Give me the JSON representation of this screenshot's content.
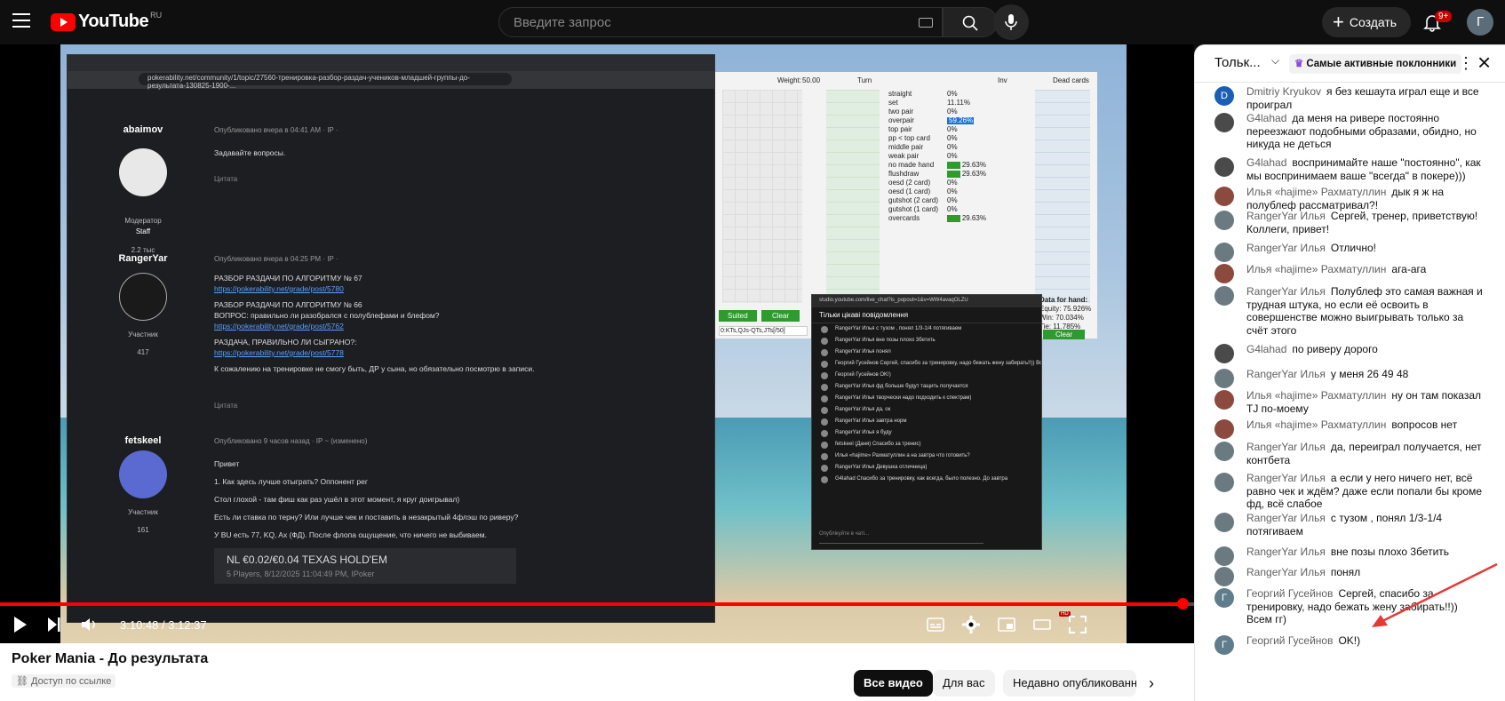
{
  "masthead": {
    "logo_text": "YouTube",
    "region": "RU",
    "search_placeholder": "Введите запрос",
    "create_label": "Создать",
    "notifications_count": "9+",
    "avatar_letter": "Г"
  },
  "player": {
    "current_time": "3:10:48",
    "duration": "3:12:37",
    "time_display": "3:10:48 / 3:12:37",
    "progress_fraction": 0.99,
    "hd_badge": "HD",
    "forum": {
      "url": "pokerability.net/community/1/topic/27560-тренировка-разбор-раздач-учеников-младшей-группы-до-результата-130825-1900-...",
      "posts": [
        {
          "author": "abaimov",
          "role": "Модератор",
          "badge": "Staff",
          "count": "2.2 тыс",
          "meta": "Опубликовано вчера в 04:41 AM · IP ·",
          "body": [
            "Задавайте вопросы."
          ],
          "quote": "Цитата"
        },
        {
          "author": "RangerYar",
          "role": "Участник",
          "count": "417",
          "meta": "Опубликовано вчера в 04:25 PM · IP ·",
          "body": [
            "РАЗБОР РАЗДАЧИ ПО АЛГОРИТМУ № 67",
            "https://pokerability.net/grade/post/5780",
            "РАЗБОР РАЗДАЧИ ПО АЛГОРИТМУ № 66",
            "ВОПРОС: правильно ли разобрался с полублефами и блефом?",
            "https://pokerability.net/grade/post/5762",
            "РАЗДАЧА, ПРАВИЛЬНО ЛИ СЫГРАНО?:",
            "https://pokerability.net/grade/post/5778",
            "К сожалению на тренировке не смогу быть, ДР у сына, но обязательно посмотрю в записи."
          ],
          "quote": "Цитата"
        },
        {
          "author": "fetskeel",
          "role": "Участник",
          "count": "161",
          "meta": "Опубликовано 9 часов назад · IP ~ (изменено)",
          "body": [
            "Привет",
            "1. Как здесь лучше отыграть? Оппонент рег",
            "Стол глохой - там фиш как раз ушёл в этот момент, я круг доигрывал)",
            "Есть ли ставка по терну? Или лучше чек и поставить в незакрытый 4флэш по риверу?",
            "У BU есть 77, KQ, Ax (ФД). После флопа ощущение, что ничего не выбиваем."
          ],
          "hand_title": "NL €0.02/€0.04 TEXAS HOLD'EM",
          "hand_sub": "5 Players, 8/12/2025 11:04:49 PM, IPoker"
        }
      ]
    },
    "calc": {
      "weight_label": "Weight:",
      "weight_value": "50.00",
      "turn_label": "Turn",
      "inv_label": "Inv",
      "dead_label": "Dead cards",
      "data_for_hand": "Data for hand:",
      "equity": "Equity: 75.926%",
      "win": "Win: 70.034%",
      "tie": "Tie: 11.785%",
      "suited": "Suited",
      "clear": "Clear",
      "clear2": "Clear",
      "range_text": "0:KTs,QJs-QTs,JTs[/50]",
      "stats": [
        {
          "name": "straight",
          "pct": "0%",
          "bar": 0
        },
        {
          "name": "set",
          "pct": "11.11%",
          "bar": 0
        },
        {
          "name": "two pair",
          "pct": "0%",
          "bar": 0
        },
        {
          "name": "overpair",
          "pct": "59.26%",
          "bar": 59.26
        },
        {
          "name": "top pair",
          "pct": "0%",
          "bar": 0
        },
        {
          "name": "pp < top card",
          "pct": "0%",
          "bar": 0
        },
        {
          "name": "middle pair",
          "pct": "0%",
          "bar": 0
        },
        {
          "name": "weak pair",
          "pct": "0%",
          "bar": 0
        },
        {
          "name": "no made hand",
          "pct": "29.63%",
          "bar": 29.63
        },
        {
          "name": "flushdraw",
          "pct": "29.63%",
          "bar": 29.63
        },
        {
          "name": "oesd (2 card)",
          "pct": "0%",
          "bar": 0
        },
        {
          "name": "oesd (1 card)",
          "pct": "0%",
          "bar": 0
        },
        {
          "name": "gutshot (2 card)",
          "pct": "0%",
          "bar": 0
        },
        {
          "name": "gutshot (1 card)",
          "pct": "0%",
          "bar": 0
        },
        {
          "name": "overcards",
          "pct": "29.63%",
          "bar": 29.63
        }
      ]
    },
    "popup_chat": {
      "title": "studio.youtube.com/live_chat?is_popout=1&v=WW4avaqOLZU",
      "mode": "Тільки цікаві повідомлення",
      "input_placeholder": "Опублікуйте в чаті...",
      "messages": [
        "RangerYar Илья  с тузом , понял 1/3-1/4 потягиваем",
        "RangerYar Илья  вне позы плохо 3бетить",
        "RangerYar Илья  понял",
        "Георгий Гусейнов  Сергей, спасибо за тренировку, надо бежать жену забирать!!)) Всем гг)",
        "Георгий Гусейнов  OK!)",
        "RangerYar Илья  фд больше будут тащить получается",
        "RangerYar Илья  творчески надо подходить к спектрам)",
        "RangerYar Илья  да, ок",
        "RangerYar Илья  завтра норм",
        "RangerYar Илья  я буду",
        "fetskeel (Даня)  Спасибо за тренис)",
        "Илья «hajime» Рахматуллин  а на завтра что готовить?",
        "RangerYar Илья  Девушка отличница)",
        "G4lahad  Спасибо за тренировку, как всегда, было полезно. До завтра"
      ]
    }
  },
  "below": {
    "title": "Poker Mania - До результата",
    "privacy": "Доступ по ссылке",
    "chips": [
      "Все видео",
      "Для вас",
      "Недавно опубликованн"
    ]
  },
  "chat": {
    "mode": "Тольк...",
    "top_fans": "Самые активные поклонники",
    "messages": [
      {
        "author": "Dmitriy Kryukov",
        "text": "я без кешаута играл еще и все проиграл",
        "avatar_letter": "D",
        "avatar_color": "#1a5fb4"
      },
      {
        "author": "G4lahad",
        "text": "да меня на ривере постоянно переезжают подобными образами, обидно, но никуда не деться",
        "avatar_letter": "",
        "avatar_color": "#4a4a4a"
      },
      {
        "author": "G4lahad",
        "text": "воспринимайте наше \"постоянно\", как мы воспринимаем ваше \"всегда\" в покере)))",
        "avatar_letter": "",
        "avatar_color": "#4a4a4a"
      },
      {
        "author": "Илья «hajime» Рахматуллин",
        "text": "дык я ж на полублеф рассматривал?!",
        "avatar_letter": "",
        "avatar_color": "#8c4a3e"
      },
      {
        "author": "RangerYar Илья",
        "text": "Сергей, тренер, приветствую! Коллеги, привет!",
        "avatar_letter": "",
        "avatar_color": "#6b7a80"
      },
      {
        "author": "RangerYar Илья",
        "text": "Отлично!",
        "avatar_letter": "",
        "avatar_color": "#6b7a80"
      },
      {
        "author": "Илья «hajime» Рахматуллин",
        "text": "ага-ага",
        "avatar_letter": "",
        "avatar_color": "#8c4a3e"
      },
      {
        "author": "RangerYar Илья",
        "text": "Полублеф это самая важная и трудная штука, но если её освоить в совершенстве можно выигрывать только за счёт этого",
        "avatar_letter": "",
        "avatar_color": "#6b7a80"
      },
      {
        "author": "G4lahad",
        "text": "по риверу дорого",
        "avatar_letter": "",
        "avatar_color": "#4a4a4a"
      },
      {
        "author": "RangerYar Илья",
        "text": "у меня 26 49 48",
        "avatar_letter": "",
        "avatar_color": "#6b7a80"
      },
      {
        "author": "Илья «hajime» Рахматуллин",
        "text": "ну он там показал TJ по-моему",
        "avatar_letter": "",
        "avatar_color": "#8c4a3e"
      },
      {
        "author": "Илья «hajime» Рахматуллин",
        "text": "вопросов нет",
        "avatar_letter": "",
        "avatar_color": "#8c4a3e"
      },
      {
        "author": "RangerYar Илья",
        "text": "да, переиграл получается, нет контбета",
        "avatar_letter": "",
        "avatar_color": "#6b7a80"
      },
      {
        "author": "RangerYar Илья",
        "text": "а если у него ничего нет, всё равно чек и ждём? даже если попали бы кроме фд, всё слабое",
        "avatar_letter": "",
        "avatar_color": "#6b7a80"
      },
      {
        "author": "RangerYar Илья",
        "text": "с тузом , понял 1/3-1/4 потягиваем",
        "avatar_letter": "",
        "avatar_color": "#6b7a80"
      },
      {
        "author": "RangerYar Илья",
        "text": "вне позы плохо 3бетить",
        "avatar_letter": "",
        "avatar_color": "#6b7a80"
      },
      {
        "author": "RangerYar Илья",
        "text": "понял",
        "avatar_letter": "",
        "avatar_color": "#6b7a80"
      },
      {
        "author": "Георгий Гусейнов",
        "text": "Сергей, спасибо за тренировку, надо бежать жену забирать!!)) Всем гг)",
        "avatar_letter": "Г",
        "avatar_color": "#607d8b"
      },
      {
        "author": "Георгий Гусейнов",
        "text": "OK!)",
        "avatar_letter": "Г",
        "avatar_color": "#607d8b"
      }
    ]
  },
  "colors": {
    "accent": "#ff0000",
    "link": "#5aa0ff",
    "bar_green": "#2e9b2e",
    "bar_blue": "#1e6fd9"
  }
}
